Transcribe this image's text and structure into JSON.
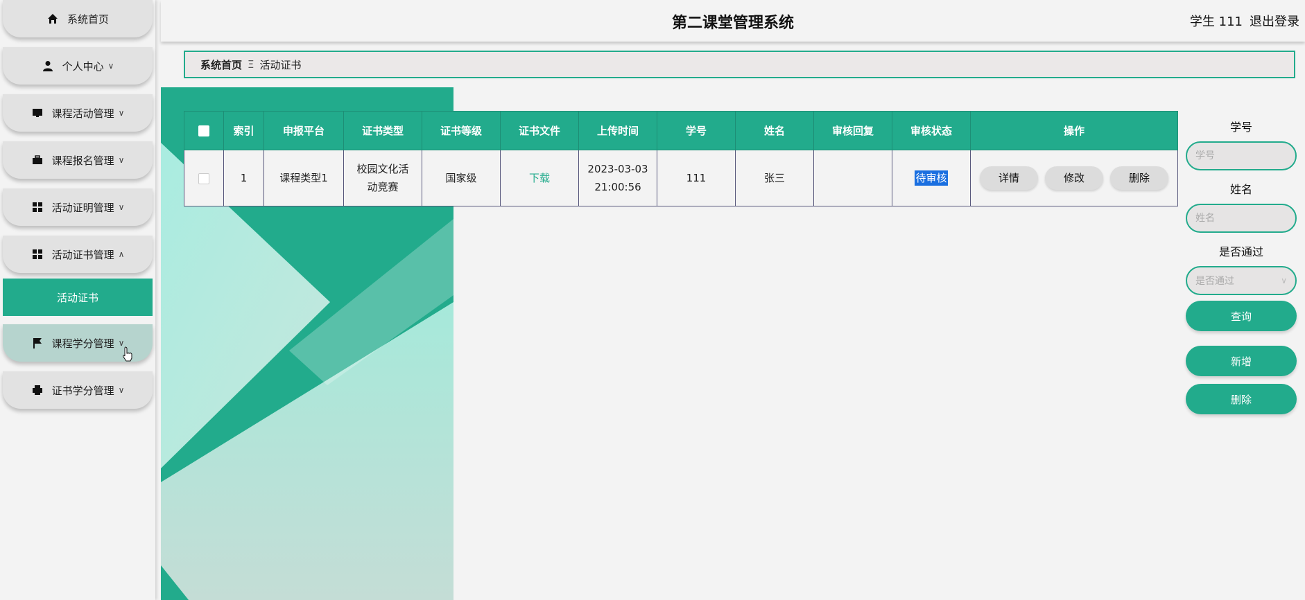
{
  "app": {
    "title": "第二课堂管理系统"
  },
  "user": {
    "name": "学生 111",
    "logout": "退出登录"
  },
  "sidebar": {
    "items": [
      {
        "label": "系统首页",
        "icon": "home-icon",
        "has_chevron": false
      },
      {
        "label": "个人中心",
        "icon": "person-icon",
        "has_chevron": true
      },
      {
        "label": "课程活动管理",
        "icon": "monitor-icon",
        "has_chevron": true
      },
      {
        "label": "课程报名管理",
        "icon": "briefcase-icon",
        "has_chevron": true
      },
      {
        "label": "活动证明管理",
        "icon": "grid-icon",
        "has_chevron": true
      },
      {
        "label": "活动证书管理",
        "icon": "grid-icon",
        "has_chevron": true,
        "expanded": true
      },
      {
        "label": "课程学分管理",
        "icon": "flag-icon",
        "has_chevron": true,
        "hovered": true
      },
      {
        "label": "证书学分管理",
        "icon": "printer-icon",
        "has_chevron": true
      }
    ],
    "active_sub": "活动证书"
  },
  "breadcrumb": {
    "home": "系统首页",
    "separator": "Ξ",
    "current": "活动证书"
  },
  "table": {
    "headers": [
      "索引",
      "申报平台",
      "证书类型",
      "证书等级",
      "证书文件",
      "上传时间",
      "学号",
      "姓名",
      "审核回复",
      "审核状态",
      "操作"
    ],
    "rows": [
      {
        "index": "1",
        "platform": "课程类型1",
        "cert_type": "校园文化活动竞赛",
        "cert_level": "国家级",
        "file": "下载",
        "upload_time": "2023-03-03 21:00:56",
        "student_id": "111",
        "name": "张三",
        "reply": "",
        "status": "待审核",
        "actions": [
          "详情",
          "修改",
          "删除"
        ]
      }
    ]
  },
  "search": {
    "student_id_label": "学号",
    "student_id_placeholder": "学号",
    "name_label": "姓名",
    "name_placeholder": "姓名",
    "pass_label": "是否通过",
    "pass_placeholder": "是否通过",
    "query_button": "查询",
    "add_button": "新增",
    "delete_button": "删除"
  },
  "colors": {
    "accent": "#22ab8c",
    "status_highlight": "#1a6fe0"
  }
}
